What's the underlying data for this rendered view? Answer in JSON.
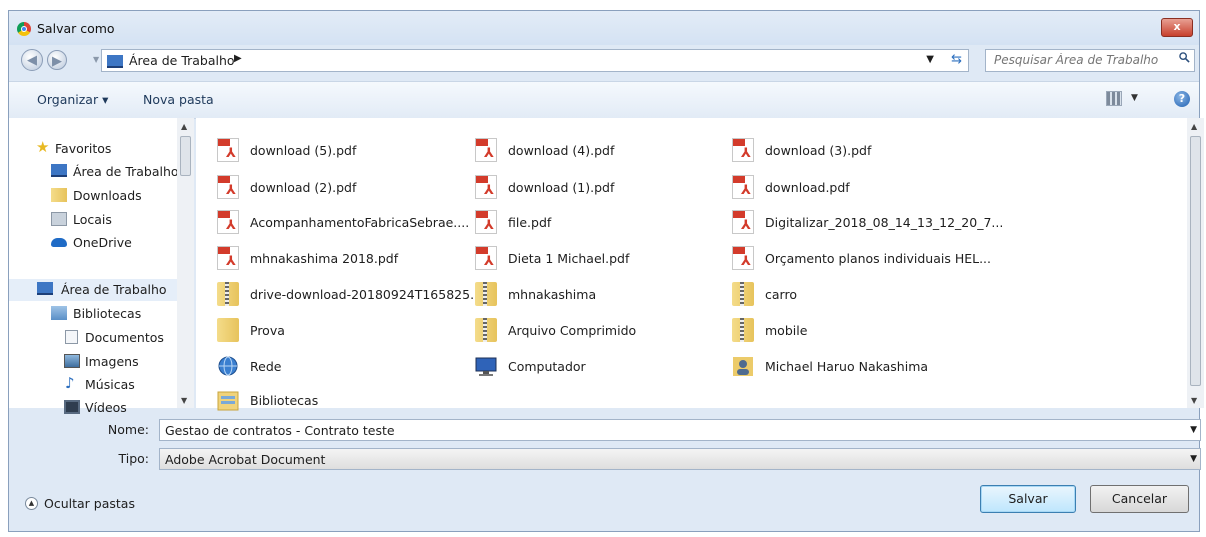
{
  "window": {
    "title": "Salvar como",
    "close_label": "x"
  },
  "address": {
    "location": "Área de Trabalho",
    "search_placeholder": "Pesquisar Área de Trabalho"
  },
  "toolbar": {
    "organize_label": "Organizar ▾",
    "new_folder_label": "Nova pasta",
    "help_label": "?"
  },
  "nav": {
    "items": [
      {
        "label": "Favoritos",
        "icon": "star-icon"
      },
      {
        "label": "Área de Trabalho",
        "icon": "desktop-icon"
      },
      {
        "label": "Downloads",
        "icon": "downloads-icon"
      },
      {
        "label": "Locais",
        "icon": "recent-places-icon"
      },
      {
        "label": "OneDrive",
        "icon": "onedrive-icon"
      },
      {
        "label": "Área de Trabalho",
        "icon": "desktop-icon"
      },
      {
        "label": "Bibliotecas",
        "icon": "libraries-icon"
      },
      {
        "label": "Documentos",
        "icon": "documents-icon"
      },
      {
        "label": "Imagens",
        "icon": "pictures-icon"
      },
      {
        "label": "Músicas",
        "icon": "music-icon"
      },
      {
        "label": "Vídeos",
        "icon": "videos-icon"
      }
    ]
  },
  "files": [
    {
      "name": "download (5).pdf",
      "type": "pdf"
    },
    {
      "name": "download (4).pdf",
      "type": "pdf"
    },
    {
      "name": "download (3).pdf",
      "type": "pdf"
    },
    {
      "name": "download (2).pdf",
      "type": "pdf"
    },
    {
      "name": "download (1).pdf",
      "type": "pdf"
    },
    {
      "name": "download.pdf",
      "type": "pdf"
    },
    {
      "name": "AcompanhamentoFabricaSebrae....",
      "type": "pdf"
    },
    {
      "name": "file.pdf",
      "type": "pdf"
    },
    {
      "name": "Digitalizar_2018_08_14_13_12_20_7...",
      "type": "pdf"
    },
    {
      "name": "mhnakashima 2018.pdf",
      "type": "pdf"
    },
    {
      "name": "Dieta 1 Michael.pdf",
      "type": "pdf"
    },
    {
      "name": "Orçamento planos individuais HEL...",
      "type": "pdf"
    },
    {
      "name": "drive-download-20180924T165825...",
      "type": "zip"
    },
    {
      "name": "mhnakashima",
      "type": "zip"
    },
    {
      "name": "carro",
      "type": "zip"
    },
    {
      "name": "Prova",
      "type": "folder"
    },
    {
      "name": "Arquivo Comprimido",
      "type": "zip"
    },
    {
      "name": "mobile",
      "type": "zip"
    },
    {
      "name": "Rede",
      "type": "network"
    },
    {
      "name": "Computador",
      "type": "computer"
    },
    {
      "name": "Michael Haruo Nakashima",
      "type": "user"
    },
    {
      "name": "Bibliotecas",
      "type": "libraries"
    }
  ],
  "form": {
    "name_label": "Nome:",
    "name_value": "Gestao de contratos - Contrato teste",
    "type_label": "Tipo:",
    "type_value": "Adobe Acrobat Document"
  },
  "footer": {
    "hide_folders_label": "Ocultar pastas",
    "save_label": "Salvar",
    "cancel_label": "Cancelar"
  },
  "colors": {
    "accent": "#3c7fb1",
    "pdf": "#d33b2b",
    "folder": "#e7c35c"
  }
}
